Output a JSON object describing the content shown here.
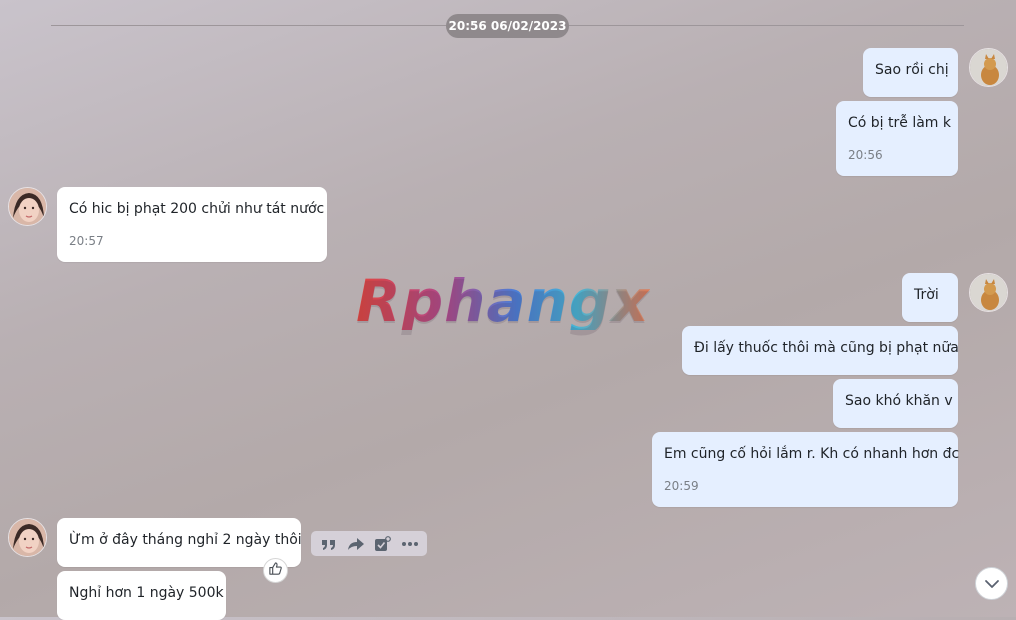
{
  "chat": {
    "date_separator": "20:56 06/02/2023",
    "messages": [
      {
        "text": "Sao rồi chị",
        "time": ""
      },
      {
        "text": "Có bị trễ làm k",
        "time": "20:56"
      },
      {
        "text": "Có hic bị phạt 200 chửi như tát nước",
        "time": "20:57"
      },
      {
        "text": "Trời",
        "time": ""
      },
      {
        "text": "Đi lấy thuốc thôi mà cũng bị phạt nữa",
        "time": ""
      },
      {
        "text": "Sao khó khăn v",
        "time": ""
      },
      {
        "text": "Em cũng cố hỏi lắm r. Kh có nhanh hơn đc",
        "time": "20:59"
      },
      {
        "text": "Ừm ở đây tháng nghỉ 2 ngày thôi",
        "time": ""
      },
      {
        "text": "Nghỉ hơn 1 ngày 500k",
        "time": ""
      }
    ]
  },
  "watermark": {
    "text": "Rphangx"
  },
  "message_actions": {
    "icons": [
      "quote-icon",
      "share-icon",
      "task-icon",
      "more-icon"
    ],
    "like_icon": "thumbs-up-icon"
  },
  "scroll_down_icon": "chevron-down-icon",
  "colors": {
    "outgoing_bubble": "#e5efff",
    "incoming_bubble": "#ffffff",
    "date_pill": "#8f898c"
  }
}
